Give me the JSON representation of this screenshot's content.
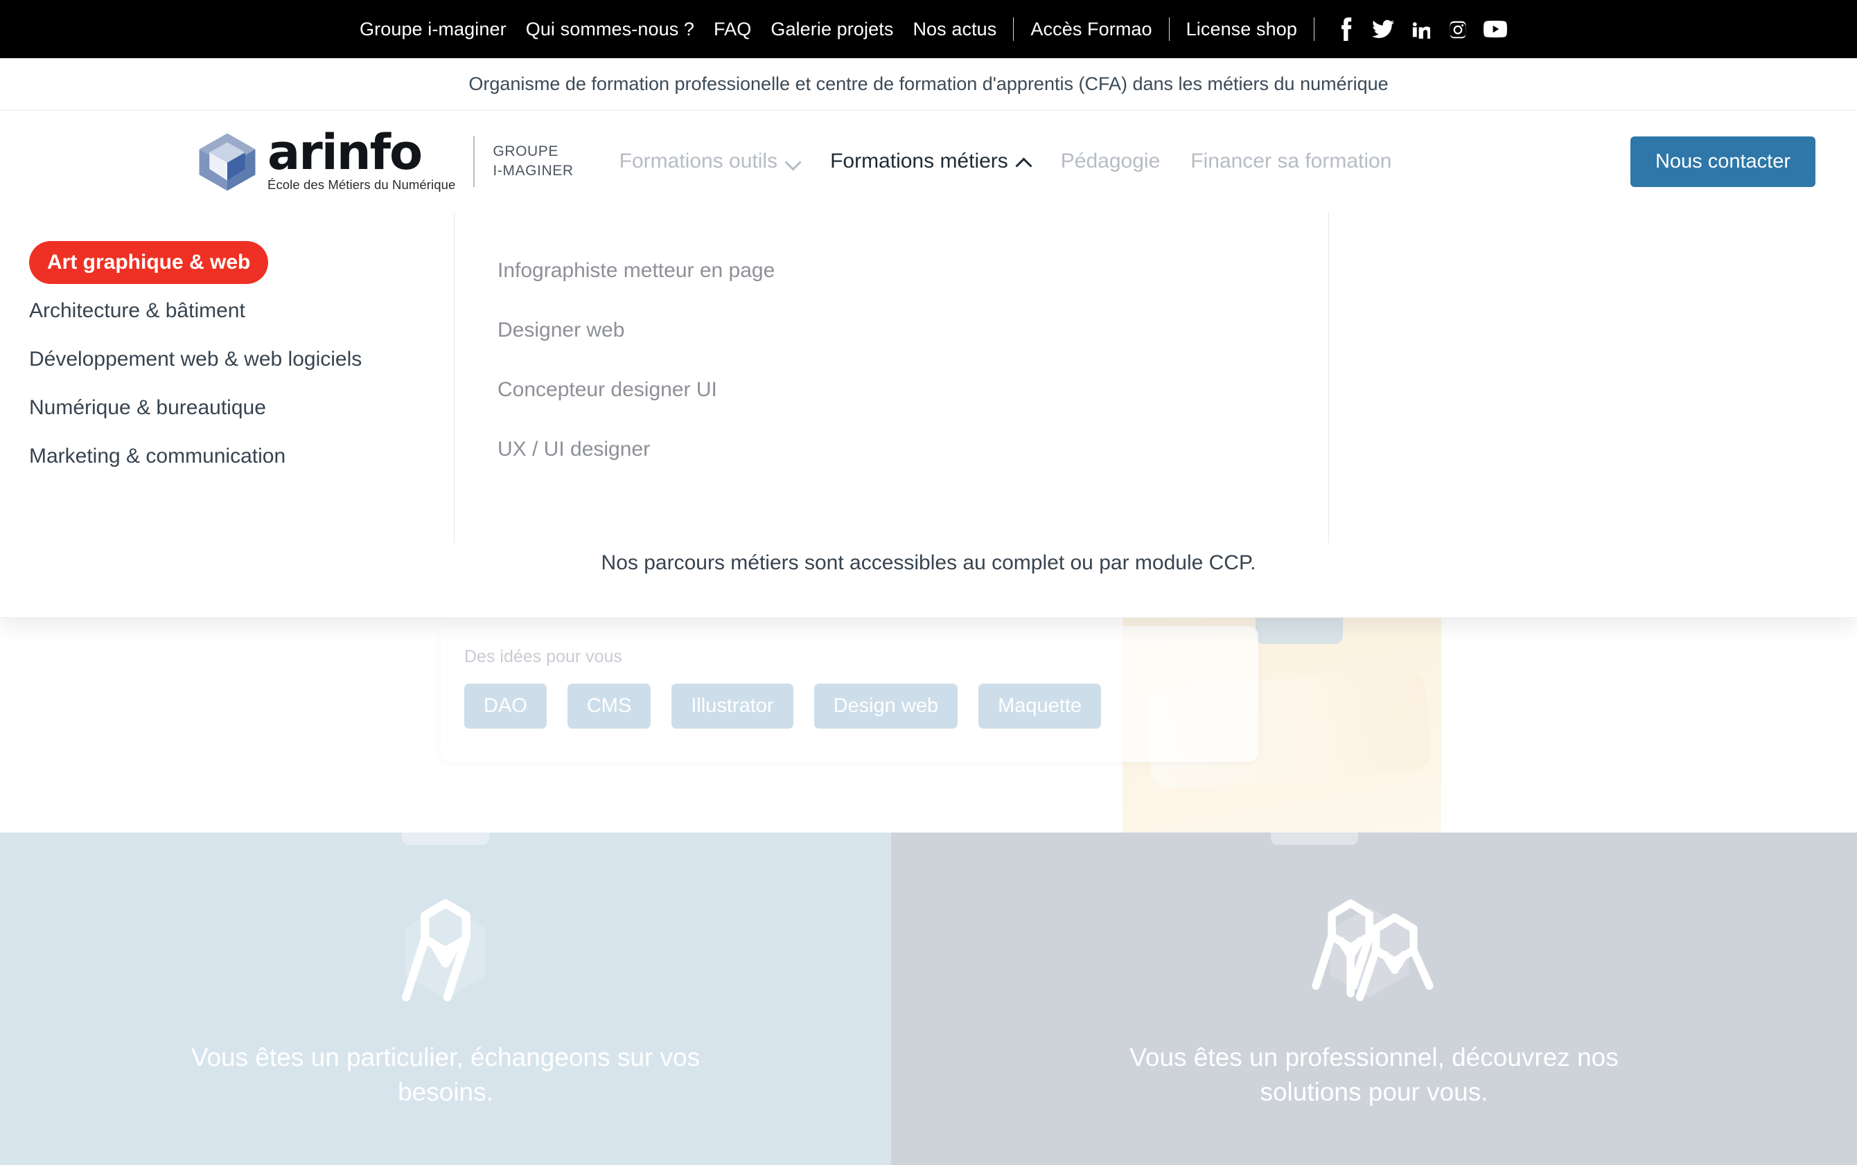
{
  "topbar": {
    "links": [
      {
        "label": "Groupe i-maginer"
      },
      {
        "label": "Qui sommes-nous ?"
      },
      {
        "label": "FAQ"
      },
      {
        "label": "Galerie projets"
      },
      {
        "label": "Nos actus"
      }
    ],
    "links_right": [
      {
        "label": "Accès Formao"
      },
      {
        "label": "License shop"
      }
    ],
    "social": [
      {
        "name": "facebook-icon"
      },
      {
        "name": "twitter-icon"
      },
      {
        "name": "linkedin-icon"
      },
      {
        "name": "instagram-icon"
      },
      {
        "name": "youtube-icon"
      }
    ]
  },
  "tagline": "Organisme de formation professionelle et centre de formation d'apprentis (CFA) dans les métiers du numérique",
  "header": {
    "logo": {
      "word": "arinfo",
      "subtitle": "École des Métiers du Numérique",
      "group_line1": "GROUPE",
      "group_line2": "I-MAGINER"
    },
    "nav": [
      {
        "label": "Formations outils",
        "caret": "down",
        "active": false
      },
      {
        "label": "Formations métiers",
        "caret": "up",
        "active": true
      },
      {
        "label": "Pédagogie",
        "caret": "",
        "active": false
      },
      {
        "label": "Financer sa formation",
        "caret": "",
        "active": false
      }
    ],
    "contact_button": "Nous contacter"
  },
  "megamenu": {
    "categories": [
      {
        "label": "Art graphique & web",
        "active": true
      },
      {
        "label": "Architecture & bâtiment",
        "active": false
      },
      {
        "label": "Développement web & web logiciels",
        "active": false
      },
      {
        "label": "Numérique & bureautique",
        "active": false
      },
      {
        "label": "Marketing & communication",
        "active": false
      }
    ],
    "courses": [
      {
        "label": "Infographiste metteur en page"
      },
      {
        "label": "Designer web"
      },
      {
        "label": "Concepteur designer UI"
      },
      {
        "label": "UX / UI designer"
      }
    ],
    "note": "Nos parcours métiers sont accessibles au complet ou par module CCP.",
    "accent_color": "#ee3124"
  },
  "hero": {
    "card_title": "Des idées pour vous",
    "tags": [
      {
        "label": "DAO"
      },
      {
        "label": "CMS"
      },
      {
        "label": "Illustrator"
      },
      {
        "label": "Design web"
      },
      {
        "label": "Maquette"
      }
    ]
  },
  "cta": {
    "left": {
      "icon": "single-person-hexagon-icon",
      "title": "Vous êtes un particulier, échangeons sur vos besoins.",
      "background": "#d7e4ec"
    },
    "right": {
      "icon": "group-people-hexagon-icon",
      "title": "Vous êtes un professionnel, découvrez nos solutions pour vous.",
      "background": "#ced3da"
    }
  }
}
